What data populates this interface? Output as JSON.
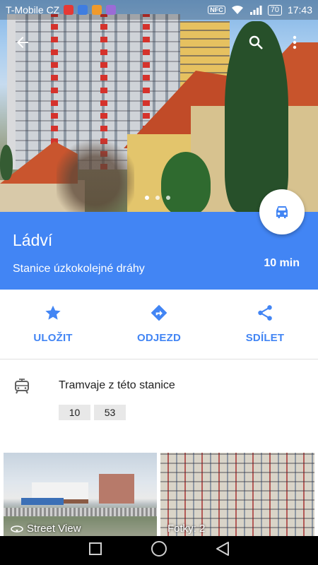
{
  "status_bar": {
    "carrier": "T-Mobile CZ",
    "nfc": "NFC",
    "battery": "70",
    "time": "17:43",
    "app_icon_colors": [
      "#e53935",
      "#3f7de0",
      "#f09a2c",
      "#9b6bd6"
    ]
  },
  "header": {
    "back_icon": "arrow-back-icon",
    "search_icon": "search-icon",
    "more_icon": "more-vert-icon",
    "photo_count_dots": 3,
    "active_dot": 0
  },
  "place": {
    "title": "Ládví",
    "subtitle": "Stanice úzkokolejné dráhy",
    "eta": "10 min",
    "fab_icon": "car-icon"
  },
  "actions": [
    {
      "label": "ULOŽIT",
      "icon": "star-icon"
    },
    {
      "label": "ODJEZD",
      "icon": "directions-icon"
    },
    {
      "label": "SDÍLET",
      "icon": "share-icon"
    }
  ],
  "transit": {
    "title": "Tramvaje z této stanice",
    "icon": "tram-icon",
    "lines": [
      "10",
      "53"
    ]
  },
  "photos": {
    "street_view": "Street View",
    "gallery": "Fotky: 2"
  },
  "colors": {
    "accent": "#4285f4",
    "chip_bg": "#e8e8e8"
  },
  "navbar": {
    "back": "triangle-back-icon",
    "home": "circle-home-icon",
    "recents": "square-recents-icon"
  }
}
